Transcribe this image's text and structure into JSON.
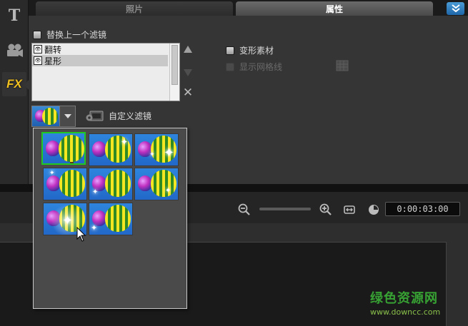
{
  "tabs": [
    {
      "label": "照片",
      "active": false
    },
    {
      "label": "属性",
      "active": true
    }
  ],
  "left_toolbar": [
    {
      "icon": "title-icon",
      "glyph": "T"
    },
    {
      "icon": "film-camera-icon"
    },
    {
      "icon": "fx-icon",
      "glyph": "FX",
      "active": true
    }
  ],
  "options": {
    "replace_last_filter": "替换上一个滤镜",
    "transform_clip": "变形素材",
    "show_grid": "显示网格线"
  },
  "filter_list": {
    "items": [
      {
        "label": "翻转",
        "selected": false
      },
      {
        "label": "星形",
        "selected": true
      }
    ]
  },
  "custom_filter_label": "自定义滤镜",
  "presets": {
    "count": 8,
    "selected_index": 0
  },
  "timeline": {
    "timecode": "0:00:03:00"
  },
  "watermark": {
    "title": "绿色资源网",
    "url": "www.downcc.com"
  },
  "colors": {
    "accent_blue": "#1e66a8",
    "selection_green": "#22c822",
    "watermark_green": "#37a233"
  }
}
